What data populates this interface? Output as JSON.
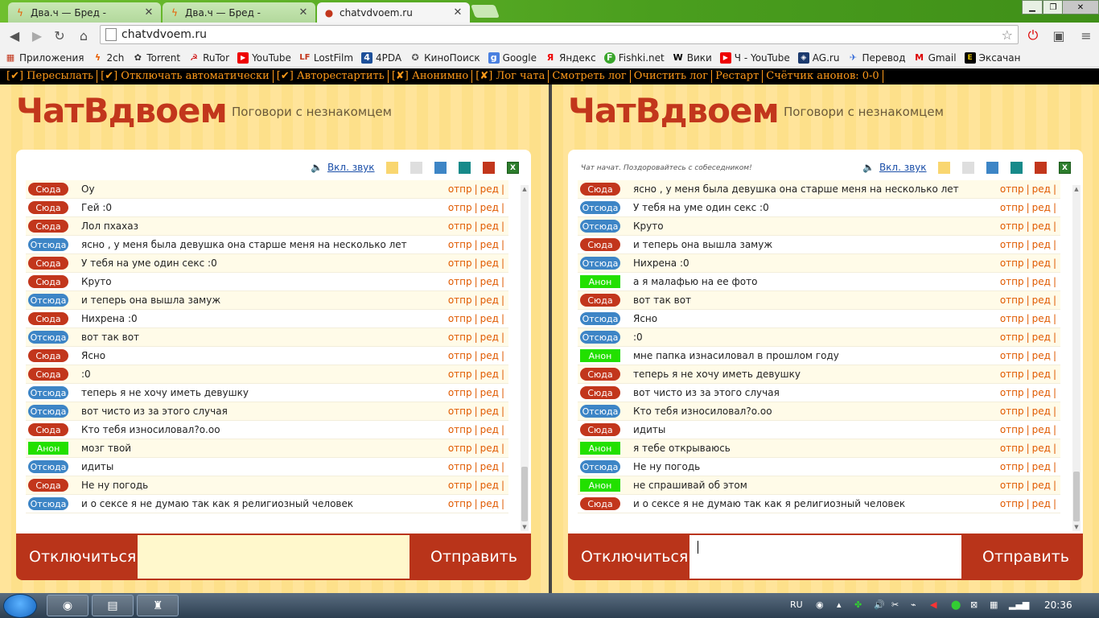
{
  "browser": {
    "tabs": [
      {
        "title": "Два.ч — Бред -",
        "state": "inactive"
      },
      {
        "title": "Два.ч — Бред -",
        "state": "inactive"
      },
      {
        "title": "chatvdvoem.ru",
        "state": "active"
      }
    ],
    "url": "chatvdvoem.ru",
    "bookmarks": [
      "Приложения",
      "2ch",
      "Torrent",
      "RuTor",
      "YouTube",
      "LostFilm",
      "4PDA",
      "КиноПоиск",
      "Google",
      "Яндекс",
      "Fishki.net",
      "Вики",
      "Ч - YouTube",
      "AG.ru",
      "Перевод",
      "Gmail",
      "Эксачан"
    ]
  },
  "controls": [
    "[✔] Пересылать",
    "[✔] Отключать автоматически",
    "[✔] Авторестартить",
    "[✘] Анонимно",
    "[✘] Лог чата",
    "Смотреть лог",
    "Очистить лог",
    "Рестарт",
    "Счётчик анонов: 0-0"
  ],
  "site": {
    "logo": "ЧатВдвоем",
    "tagline": "Поговори с незнакомцем",
    "sound_link": "Вкл. звук",
    "disconnect_label": "Отключиться",
    "send_label": "Отправить",
    "reply_action": "отпр",
    "edit_action": "ред",
    "swatches": [
      "#f9d670",
      "#dedede",
      "#3d85c6",
      "#178a8a",
      "#c2361c"
    ]
  },
  "left_pane": {
    "status": "",
    "messages": [
      {
        "who": "Сюда",
        "kind": "here",
        "text": "Оу"
      },
      {
        "who": "Сюда",
        "kind": "here",
        "text": "Гей :0"
      },
      {
        "who": "Сюда",
        "kind": "here",
        "text": "Лол пхахаз"
      },
      {
        "who": "Отсюда",
        "kind": "there",
        "text": "ясно , у меня была девушка она старше меня на несколько лет"
      },
      {
        "who": "Сюда",
        "kind": "here",
        "text": "У тебя на уме один секс :0"
      },
      {
        "who": "Сюда",
        "kind": "here",
        "text": "Круто"
      },
      {
        "who": "Отсюда",
        "kind": "there",
        "text": "и теперь она вышла замуж"
      },
      {
        "who": "Сюда",
        "kind": "here",
        "text": "Нихрена :0"
      },
      {
        "who": "Отсюда",
        "kind": "there",
        "text": "вот так вот"
      },
      {
        "who": "Сюда",
        "kind": "here",
        "text": "Ясно"
      },
      {
        "who": "Сюда",
        "kind": "here",
        "text": ":0"
      },
      {
        "who": "Отсюда",
        "kind": "there",
        "text": "теперь я не хочу иметь девушку"
      },
      {
        "who": "Отсюда",
        "kind": "there",
        "text": "вот чисто из за этого случая"
      },
      {
        "who": "Сюда",
        "kind": "here",
        "text": "Кто тебя износиловал?о.оо"
      },
      {
        "who": "Анон",
        "kind": "anon",
        "text": "мозг твой"
      },
      {
        "who": "Отсюда",
        "kind": "there",
        "text": "идиты"
      },
      {
        "who": "Сюда",
        "kind": "here",
        "text": "Не ну погодь"
      },
      {
        "who": "Отсюда",
        "kind": "there",
        "text": "и о сексе я не думаю так как я религиозный человек"
      }
    ]
  },
  "right_pane": {
    "status": "Чат начат. Поздоровайтесь с собеседником!",
    "messages": [
      {
        "who": "Сюда",
        "kind": "here",
        "text": "ясно , у меня была девушка она старше меня на несколько лет"
      },
      {
        "who": "Отсюда",
        "kind": "there",
        "text": "У тебя на уме один секс :0"
      },
      {
        "who": "Отсюда",
        "kind": "there",
        "text": "Круто"
      },
      {
        "who": "Сюда",
        "kind": "here",
        "text": "и теперь она вышла замуж"
      },
      {
        "who": "Отсюда",
        "kind": "there",
        "text": "Нихрена :0"
      },
      {
        "who": "Анон",
        "kind": "anon",
        "text": "а я малафью на ее фото"
      },
      {
        "who": "Сюда",
        "kind": "here",
        "text": "вот так вот"
      },
      {
        "who": "Отсюда",
        "kind": "there",
        "text": "Ясно"
      },
      {
        "who": "Отсюда",
        "kind": "there",
        "text": ":0"
      },
      {
        "who": "Анон",
        "kind": "anon",
        "text": "мне папка изнасиловал в прошлом году"
      },
      {
        "who": "Сюда",
        "kind": "here",
        "text": "теперь я не хочу иметь девушку"
      },
      {
        "who": "Сюда",
        "kind": "here",
        "text": "вот чисто из за этого случая"
      },
      {
        "who": "Отсюда",
        "kind": "there",
        "text": "Кто тебя износиловал?о.оо"
      },
      {
        "who": "Сюда",
        "kind": "here",
        "text": "идиты"
      },
      {
        "who": "Анон",
        "kind": "anon",
        "text": "я тебе открываюсь"
      },
      {
        "who": "Отсюда",
        "kind": "there",
        "text": "Не ну погодь"
      },
      {
        "who": "Анон",
        "kind": "anon",
        "text": "не спрашивай об этом"
      },
      {
        "who": "Сюда",
        "kind": "here",
        "text": "и о сексе я не думаю так как я религиозный человек"
      }
    ]
  },
  "taskbar": {
    "lang": "RU",
    "clock": "20:36"
  }
}
